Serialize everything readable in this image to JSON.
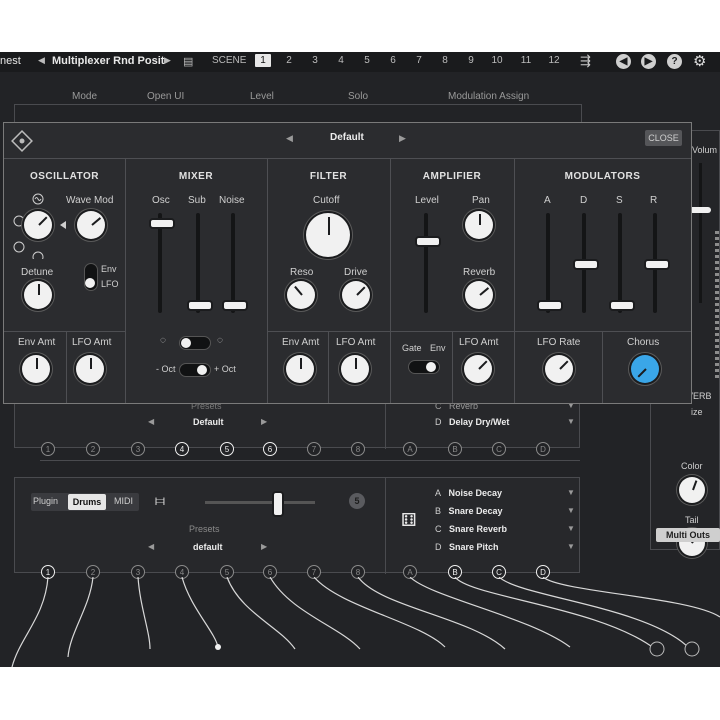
{
  "topbar": {
    "app_name_fragment": "nest",
    "preset_name": "Multiplexer Rnd Posit",
    "scene_label": "SCENE",
    "scenes": [
      "1",
      "2",
      "3",
      "4",
      "5",
      "6",
      "7",
      "8",
      "9",
      "10",
      "11",
      "12"
    ],
    "selected_scene": "1"
  },
  "header": {
    "mode": "Mode",
    "open_ui": "Open UI",
    "level": "Level",
    "solo": "Solo",
    "modulation_assign": "Modulation Assign"
  },
  "synth": {
    "preset": "Default",
    "close_label": "CLOSE",
    "sections": {
      "oscillator": {
        "title": "OSCILLATOR",
        "wave_mod": "Wave Mod",
        "detune": "Detune",
        "env": "Env",
        "lfo": "LFO",
        "env_amt": "Env Amt",
        "lfo_amt": "LFO Amt"
      },
      "mixer": {
        "title": "MIXER",
        "osc": "Osc",
        "sub": "Sub",
        "noise": "Noise",
        "minus_oct": "- Oct",
        "plus_oct": "+ Oct"
      },
      "filter": {
        "title": "FILTER",
        "cutoff": "Cutoff",
        "reso": "Reso",
        "drive": "Drive",
        "env_amt": "Env Amt",
        "lfo_amt": "LFO Amt"
      },
      "amplifier": {
        "title": "AMPLIFIER",
        "level": "Level",
        "pan": "Pan",
        "reverb": "Reverb",
        "gate": "Gate",
        "env": "Env",
        "lfo_amt": "LFO Amt"
      },
      "modulators": {
        "title": "MODULATORS",
        "a": "A",
        "d": "D",
        "s": "S",
        "r": "R",
        "lfo_rate": "LFO Rate",
        "chorus": "Chorus"
      }
    },
    "levels": {
      "mixer_osc": 0.95,
      "mixer_sub": 0.05,
      "mixer_noise": 0.05,
      "amp_level": 0.75,
      "mod_a": 0.05,
      "mod_d": 0.5,
      "mod_s": 0.05,
      "mod_r": 0.5
    },
    "accent_color": "#3aa6e8"
  },
  "upper_rack": {
    "presets_label": "Presets",
    "preset": "Default",
    "ports": [
      "1",
      "2",
      "3",
      "4",
      "5",
      "6",
      "7",
      "8"
    ],
    "mod_ports": [
      "A",
      "B",
      "C",
      "D"
    ],
    "mod_assign_partial": [
      {
        "slot": "C",
        "name": "Reverb"
      },
      {
        "slot": "D",
        "name": "Delay Dry/Wet"
      }
    ]
  },
  "drum_rack": {
    "tabs": [
      "Plugin",
      "Drums",
      "MIDI"
    ],
    "active_tab": "Drums",
    "badge": "5",
    "presets_label": "Presets",
    "preset": "default",
    "ports": [
      "1",
      "2",
      "3",
      "4",
      "5",
      "6",
      "7",
      "8"
    ],
    "mod_ports": [
      "A",
      "B",
      "C",
      "D"
    ],
    "mod_assign": [
      {
        "slot": "A",
        "name": "Noise Decay"
      },
      {
        "slot": "B",
        "name": "Snare Decay"
      },
      {
        "slot": "C",
        "name": "Snare Reverb"
      },
      {
        "slot": "D",
        "name": "Snare Pitch"
      }
    ]
  },
  "right_panel": {
    "volume_fragment": "Volum",
    "reverb_fragment": "VERB",
    "size_fragment": "ize",
    "color": "Color",
    "tail": "Tail",
    "multi_outs": "Multi Outs"
  }
}
